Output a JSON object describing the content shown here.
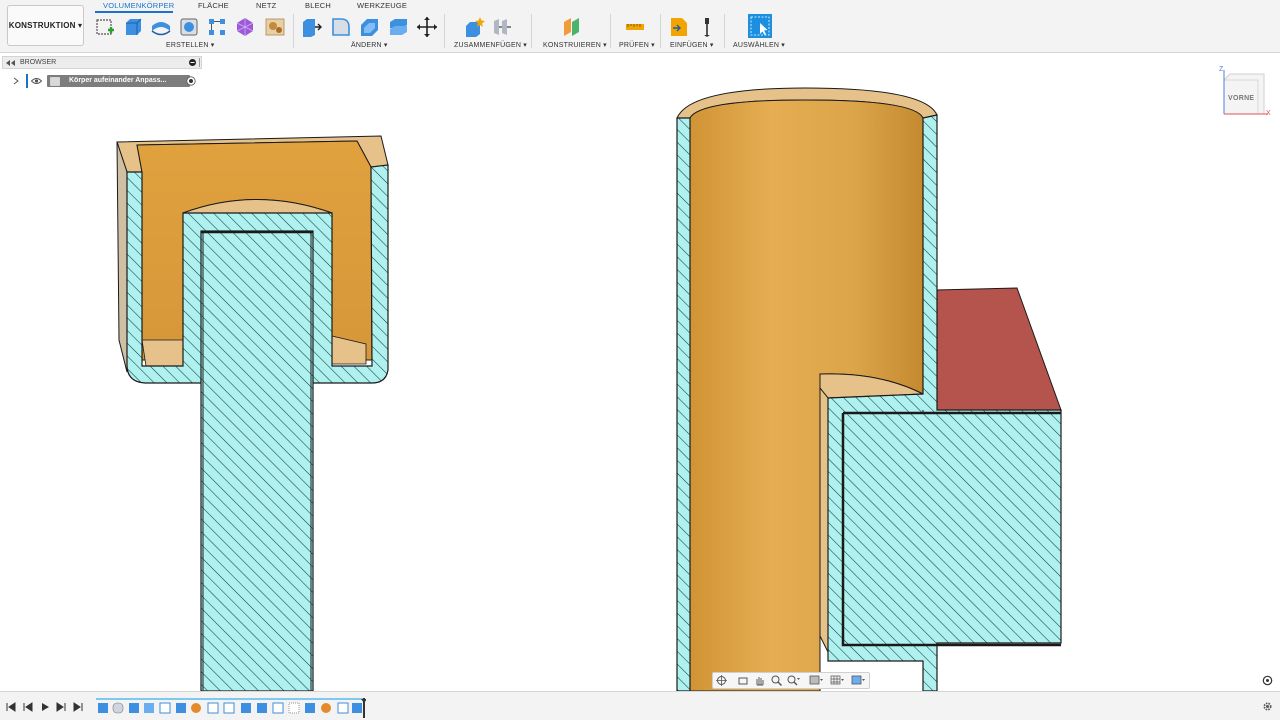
{
  "workspace": {
    "label": "KONSTRUKTION ▾"
  },
  "tabs": [
    {
      "label": "VOLUMENKÖRPER",
      "active": true
    },
    {
      "label": "FLÄCHE"
    },
    {
      "label": "NETZ"
    },
    {
      "label": "BLECH"
    },
    {
      "label": "WERKZEUGE"
    }
  ],
  "groups": {
    "create": "ERSTELLEN ▾",
    "modify": "ÄNDERN ▾",
    "assemble": "ZUSAMMENFÜGEN ▾",
    "construct": "KONSTRUIEREN ▾",
    "inspect": "PRÜFEN ▾",
    "insert": "EINFÜGEN ▾",
    "select": "AUSWÄHLEN ▾"
  },
  "browser": {
    "title": "BROWSER",
    "item": "Körper aufeinander Anpass..."
  },
  "viewcube": {
    "face": "VORNE",
    "axis_z": "Z",
    "axis_x": "X"
  },
  "colors": {
    "accent": "#1a73c8",
    "hatch_fill": "#aef1ee",
    "body_orange": "#e0a64a",
    "body_red": "#b5544c"
  }
}
